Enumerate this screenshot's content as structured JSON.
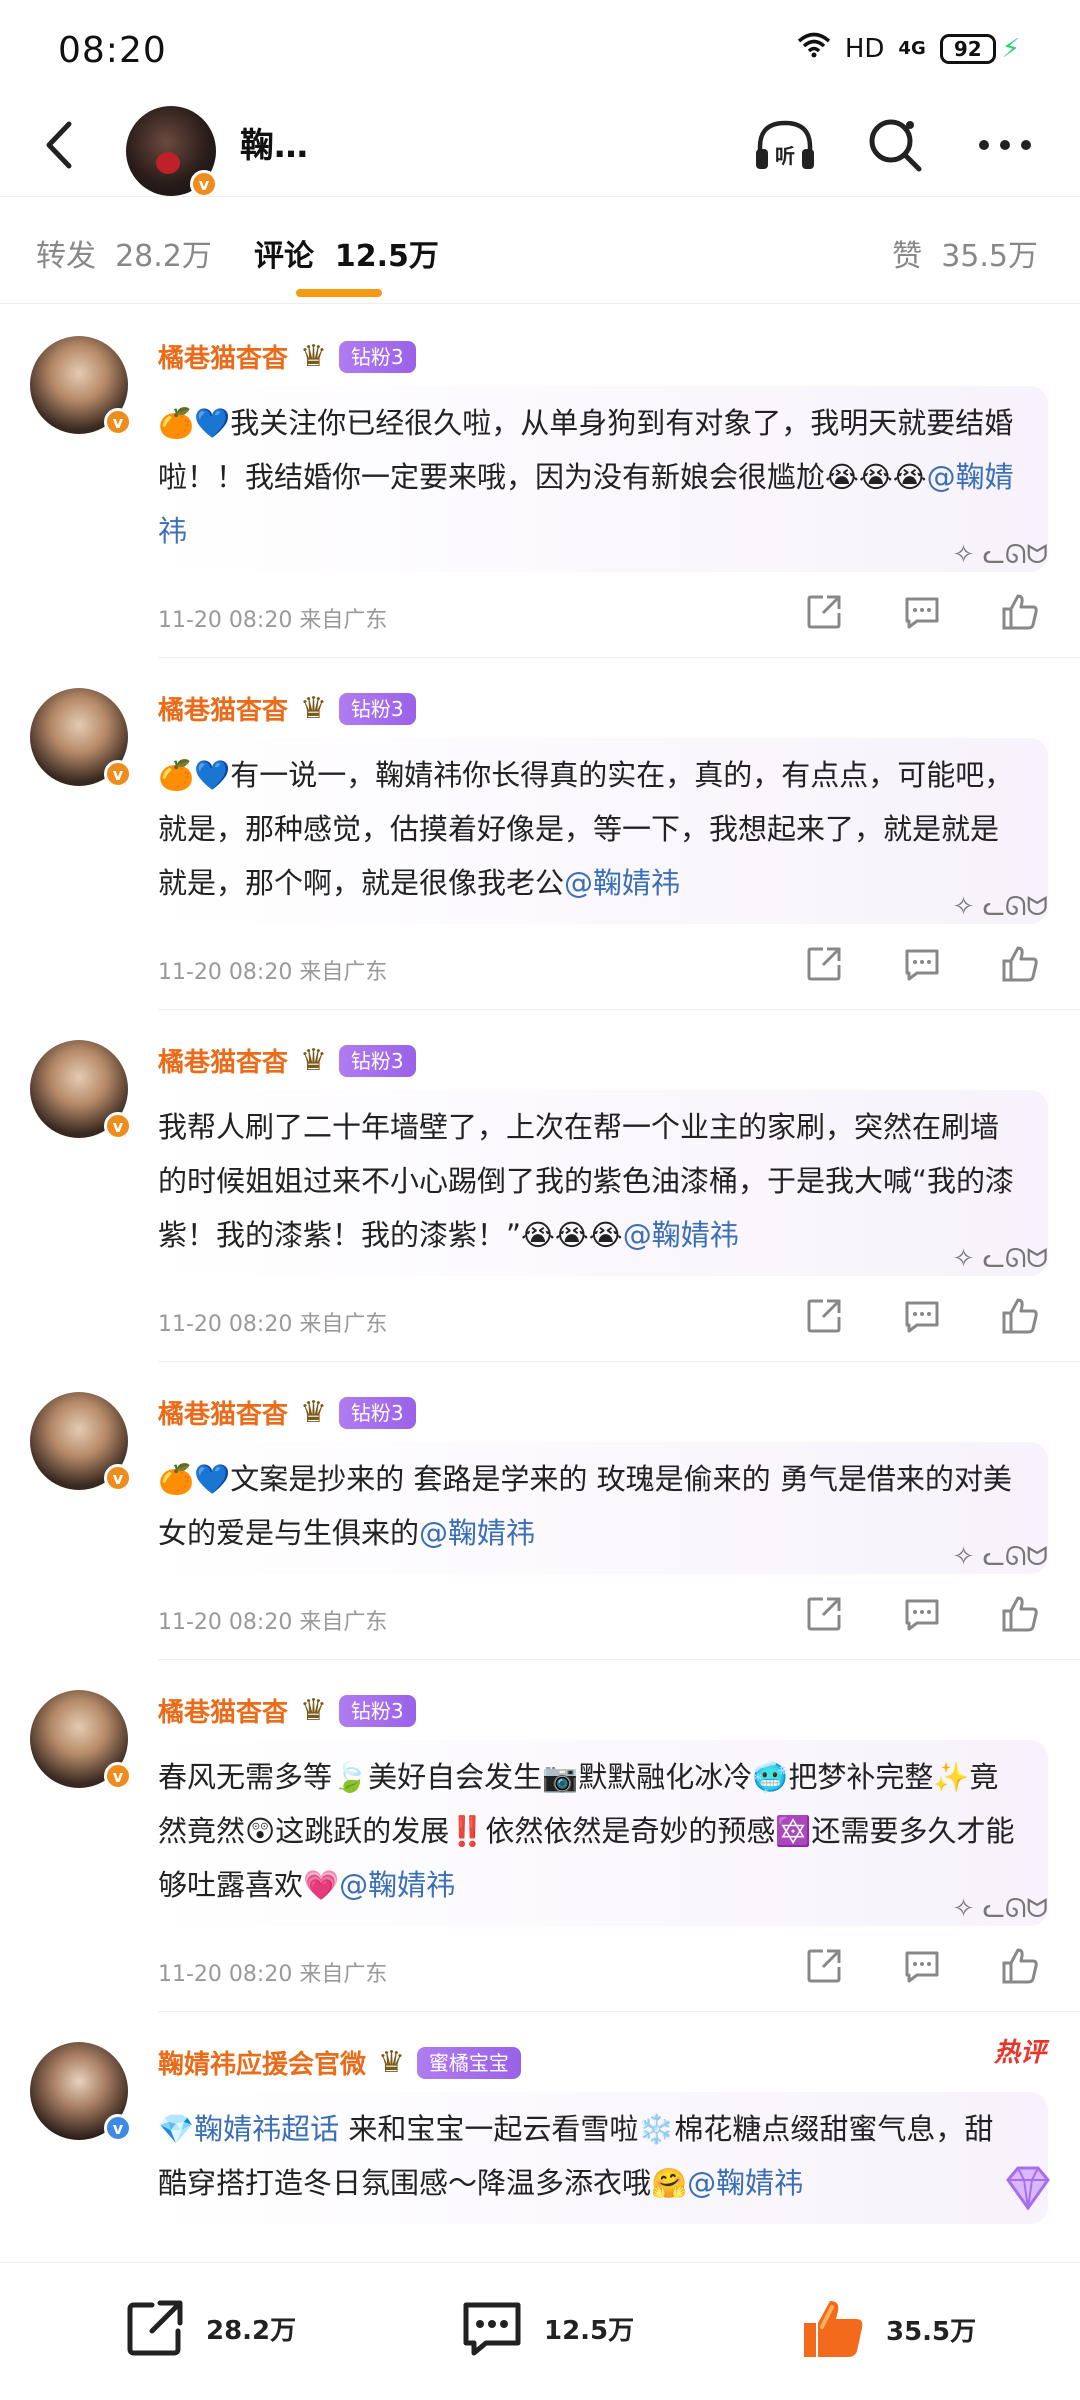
{
  "status": {
    "time": "08:20",
    "network": "HD",
    "signal": "4G",
    "battery": "92"
  },
  "header": {
    "name": "鞠…",
    "listen_icon": "headphones-listen-icon",
    "search_icon": "search-icon",
    "more_icon": "more-icon"
  },
  "tabs": {
    "repost_label": "转发",
    "repost_count": "28.2万",
    "comment_label": "评论",
    "comment_count": "12.5万",
    "like_label": "赞",
    "like_count": "35.5万"
  },
  "comments": [
    {
      "user": "橘巷猫杳杳",
      "badge": "钻粉3",
      "text": "🍊💙我关注你已经很久啦，从单身狗到有对象了，我明天就要结婚啦！！我结婚你一定要来哦，因为没有新娘会很尴尬😭😭😭",
      "mention": "@鞠婧祎",
      "meta": "11-20  08:20  来自广东"
    },
    {
      "user": "橘巷猫杳杳",
      "badge": "钻粉3",
      "text": "🍊💙有一说一，鞠婧祎你长得真的实在，真的，有点点，可能吧，就是，那种感觉，估摸着好像是，等一下，我想起来了，就是就是就是，那个啊，就是很像我老公",
      "mention": "@鞠婧祎",
      "meta": "11-20  08:20  来自广东"
    },
    {
      "user": "橘巷猫杳杳",
      "badge": "钻粉3",
      "text": "我帮人刷了二十年墙壁了，上次在帮一个业主的家刷，突然在刷墙的时候姐姐过来不小心踢倒了我的紫色油漆桶，于是我大喊“我的漆紫！我的漆紫！我的漆紫！”😭😭😭",
      "mention": "@鞠婧祎",
      "meta": "11-20  08:20  来自广东"
    },
    {
      "user": "橘巷猫杳杳",
      "badge": "钻粉3",
      "text": "🍊💙文案是抄来的  套路是学来的  玫瑰是偷来的  勇气是借来的对美女的爱是与生俱来的",
      "mention": "@鞠婧祎",
      "meta": "11-20  08:20  来自广东"
    },
    {
      "user": "橘巷猫杳杳",
      "badge": "钻粉3",
      "text": "春风无需多等🍃美好自会发生📷默默融化冰冷🥶把梦补完整✨竟然竟然😲这跳跃的发展‼️依然依然是奇妙的预感🔯还需要多久才能够吐露喜欢💗",
      "mention": "@鞠婧祎",
      "meta": "11-20  08:20  来自广东"
    },
    {
      "user": "鞠婧祎应援会官微",
      "badge": "蜜橘宝宝",
      "hot_label": "热评",
      "topic": "💎鞠婧祎超话",
      "text": " 来和宝宝一起云看雪啦❄️棉花糖点缀甜蜜气息，甜酷穿搭打造冬日氛围感～降温多添衣哦🤗",
      "mention": "@鞠婧祎"
    }
  ],
  "bottom": {
    "repost": "28.2万",
    "comment": "12.5万",
    "like": "35.5万"
  },
  "colors": {
    "accent": "#f59a12",
    "username": "#e86c1a",
    "mention": "#3b6fb6",
    "fan_badge": "#a66eec",
    "hot": "#e8362b"
  }
}
